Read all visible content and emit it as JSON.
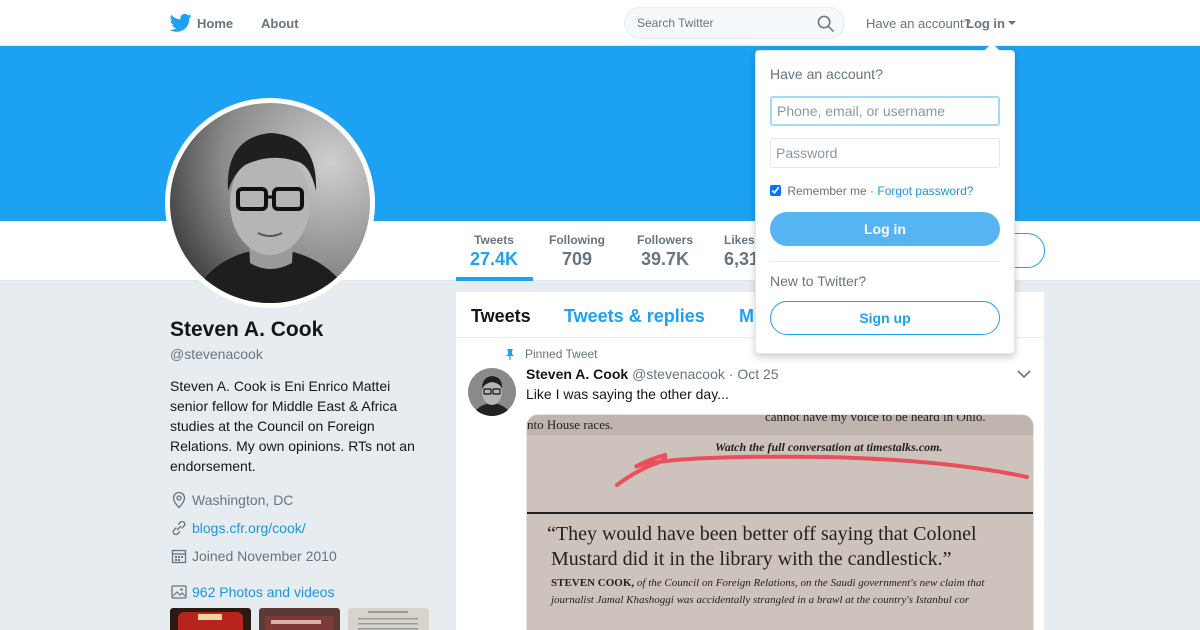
{
  "nav": {
    "home": "Home",
    "about": "About",
    "search_placeholder": "Search Twitter",
    "have_account": "Have an account?",
    "login": "Log in"
  },
  "profile": {
    "name": "Steven A. Cook",
    "handle": "@stevenacook",
    "bio": "Steven A. Cook is Eni Enrico Mattei senior fellow for Middle East & Africa studies at the Council on Foreign Relations. My own opinions. RTs not an endorsement.",
    "location": "Washington, DC",
    "url": "blogs.cfr.org/cook/",
    "joined": "Joined November 2010",
    "photos": "962 Photos and videos"
  },
  "stats": [
    {
      "label": "Tweets",
      "value": "27.4K"
    },
    {
      "label": "Following",
      "value": "709"
    },
    {
      "label": "Followers",
      "value": "39.7K"
    },
    {
      "label": "Likes",
      "value": "6,31"
    }
  ],
  "tabs": [
    "Tweets",
    "Tweets & replies",
    "M"
  ],
  "tweet": {
    "pinned_label": "Pinned Tweet",
    "name": "Steven A. Cook",
    "handle": "@stevenacook",
    "dot": "·",
    "date": "Oct 25",
    "text": "Like I was saying the other day...",
    "media": {
      "line_top": "nto House races.",
      "line_top_right": "cannot have my voice to be heard in Ohio.",
      "watch": "Watch the full conversation at timestalks.com.",
      "quote_1": "“They would have been better off saying that Colonel",
      "quote_2": "Mustard did it in the library with the candlestick.”",
      "attrib_name": "STEVEN COOK,",
      "attrib_1": " of the Council on Foreign Relations, on the Saudi government's new claim that",
      "attrib_2": "journalist Jamal Khashoggi was accidentally strangled in a brawl at the country's Istanbul cor"
    }
  },
  "dropdown": {
    "title": "Have an account?",
    "username_placeholder": "Phone, email, or username",
    "password_placeholder": "Password",
    "remember": "Remember me",
    "sep": "·",
    "forgot": "Forgot password?",
    "login_button": "Log in",
    "new_to_twitter": "New to Twitter?",
    "signup_button": "Sign up"
  },
  "colors": {
    "brand": "#1da1f2",
    "link": "#1b95e0",
    "muted": "#66757f"
  }
}
